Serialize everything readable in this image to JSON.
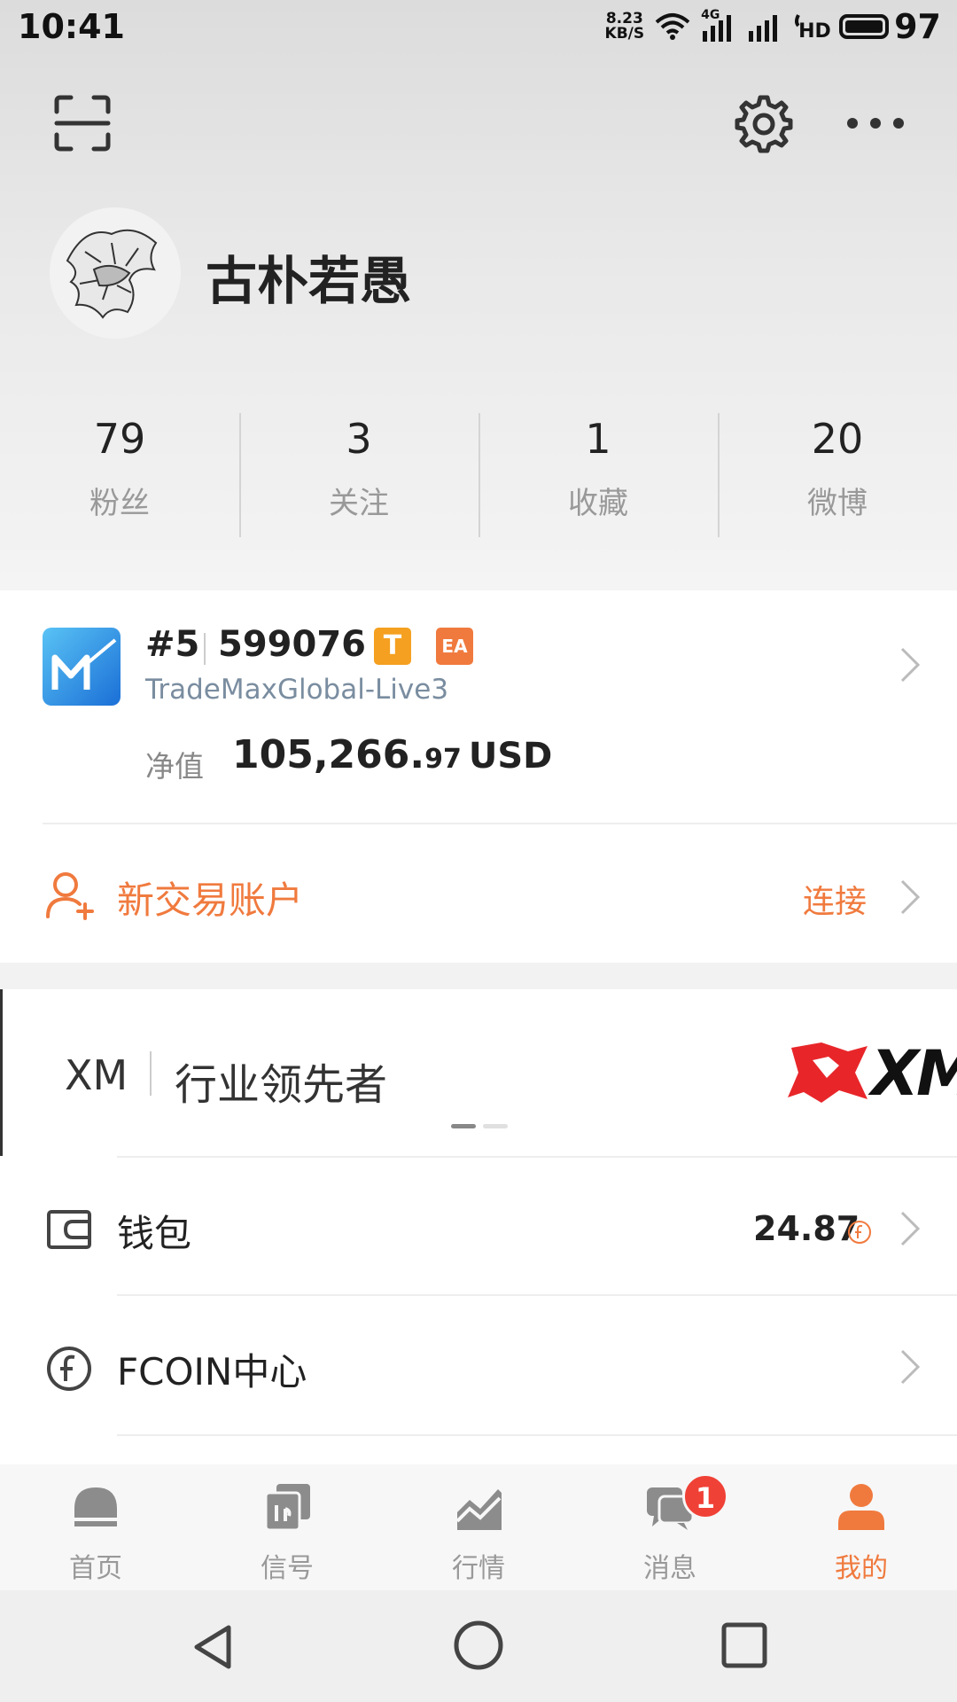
{
  "status_bar": {
    "time": "10:41",
    "net_speed_value": "8.23",
    "net_speed_unit": "KB/S",
    "network_type": "4G",
    "hd_label": "HD",
    "battery_level": "97",
    "icons": [
      "wifi-icon",
      "signal-4g-icon",
      "signal-icon",
      "hd-voice-icon",
      "battery-icon"
    ]
  },
  "top_actions": {
    "icons": [
      "scan-icon",
      "gear-icon",
      "more-icon"
    ]
  },
  "profile": {
    "username": "古朴若愚"
  },
  "stats": [
    {
      "value": "79",
      "label": "粉丝"
    },
    {
      "value": "3",
      "label": "关注"
    },
    {
      "value": "1",
      "label": "收藏"
    },
    {
      "value": "20",
      "label": "微博"
    }
  ],
  "account": {
    "rank": "#5",
    "id": "599076",
    "badge_t": "T",
    "badge_ea": "EA",
    "server": "TradeMaxGlobal-Live3",
    "equity_label": "净值",
    "equity_int": "105,266.",
    "equity_dec": "97",
    "equity_currency": "USD",
    "new_account_label": "新交易账户",
    "connect_label": "连接"
  },
  "banner": {
    "brand": "XM",
    "tagline": "行业领先者",
    "logo_text": "XM",
    "page_count": 2,
    "active_page": 1
  },
  "list": {
    "wallet_label": "钱包",
    "wallet_value": "24.87",
    "fcoin_label": "FCOIN中心"
  },
  "tabbar": {
    "tabs": [
      {
        "label": "首页",
        "icon": "home-icon",
        "active": false
      },
      {
        "label": "信号",
        "icon": "signal-cards-icon",
        "active": false
      },
      {
        "label": "行情",
        "icon": "market-chart-icon",
        "active": false
      },
      {
        "label": "消息",
        "icon": "message-icon",
        "active": false,
        "badge": "1"
      },
      {
        "label": "我的",
        "icon": "profile-icon",
        "active": true
      }
    ]
  },
  "colors": {
    "accent": "#f07a3e",
    "badge_red": "#f04137",
    "muted_text": "#999999",
    "server_text": "#7a8da0"
  }
}
